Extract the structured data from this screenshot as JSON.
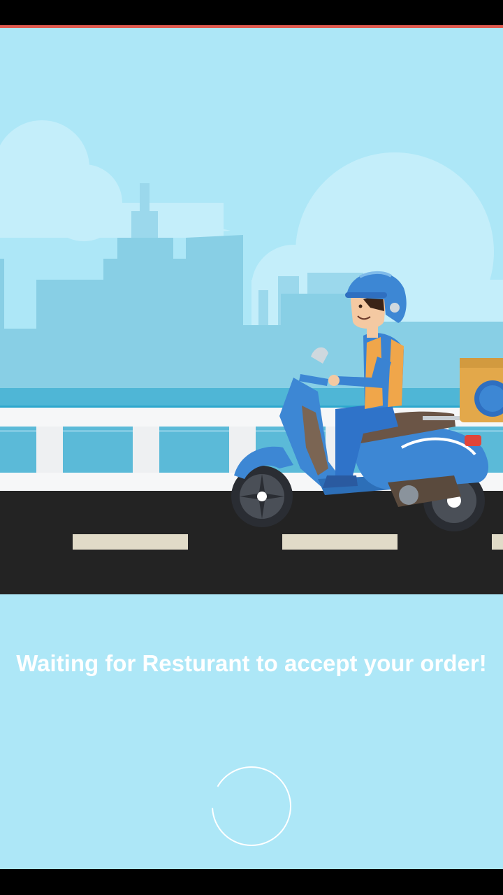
{
  "status": {
    "message": "Waiting for Resturant to accept your order!"
  },
  "loader": {
    "state": "loading"
  },
  "colors": {
    "sky": "#ade7f7",
    "accent": "#e05a4f",
    "text": "#ffffff",
    "road": "#232323"
  },
  "illustration": {
    "subject": "delivery-rider-on-scooter"
  }
}
